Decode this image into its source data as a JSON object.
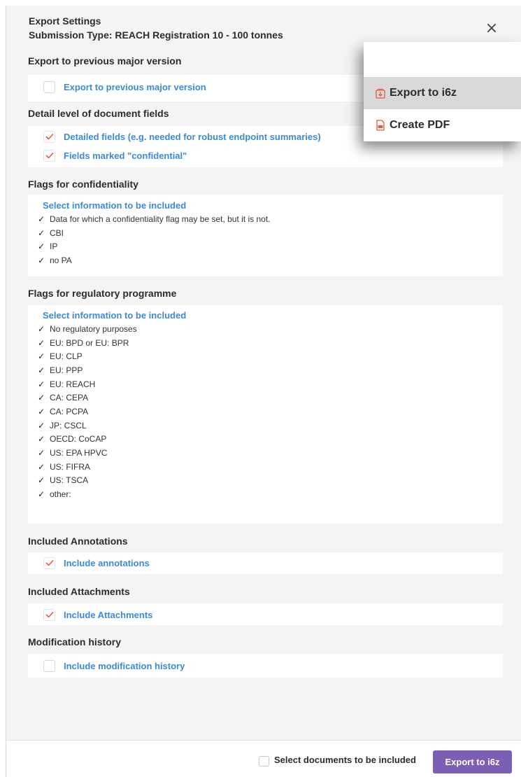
{
  "dialog": {
    "title": "Export Settings",
    "subtitle": "Submission Type: REACH Registration 10 - 100 tonnes",
    "close_symbol": "×",
    "close_icon": "close-icon"
  },
  "sections": {
    "previous_version": {
      "title": "Export to previous major version",
      "options": [
        {
          "label": "Export to previous major version",
          "checked": false
        }
      ]
    },
    "detail_level": {
      "title": "Detail level of document fields",
      "options": [
        {
          "label": "Detailed fields (e.g. needed for robust endpoint summaries)",
          "checked": true
        },
        {
          "label": "Fields marked \"confidential\"",
          "checked": true
        }
      ]
    },
    "confidentiality": {
      "title": "Flags for confidentiality",
      "select_label": "Select information to be included",
      "items": [
        "Data for which a confidentiality flag may be set, but it is not.",
        "CBI",
        "IP",
        "no PA"
      ]
    },
    "regulatory": {
      "title": "Flags for regulatory programme",
      "select_label": "Select information to be included",
      "items": [
        "No regulatory purposes",
        "EU: BPD or EU: BPR",
        "EU: CLP",
        "EU: PPP",
        "EU: REACH",
        "CA: CEPA",
        "CA: PCPA",
        "JP: CSCL",
        "OECD: CoCAP",
        "US: EPA HPVC",
        "US: FIFRA",
        "US: TSCA",
        "other:"
      ]
    },
    "annotations": {
      "title": "Included Annotations",
      "options": [
        {
          "label": "Include annotations",
          "checked": true
        }
      ]
    },
    "attachments": {
      "title": "Included Attachments",
      "options": [
        {
          "label": "Include Attachments",
          "checked": true
        }
      ]
    },
    "history": {
      "title": "Modification history",
      "options": [
        {
          "label": "Include modification history",
          "checked": false
        }
      ]
    }
  },
  "check_symbol": "✓",
  "footer": {
    "select_documents_label": "Select documents to be included",
    "select_documents_checked": false,
    "export_button": "Export to i6z"
  },
  "context_menu": {
    "items": [
      {
        "label": "Export to i6z",
        "icon": "export-i6z-icon",
        "active": true
      },
      {
        "label": "Create PDF",
        "icon": "pdf-icon",
        "active": false
      }
    ]
  },
  "colors": {
    "accent_purple": "#7a5fb5",
    "link_blue": "#3b8ad9",
    "tick_orange": "#e8593c",
    "panel_bg": "#f4f4f4"
  }
}
